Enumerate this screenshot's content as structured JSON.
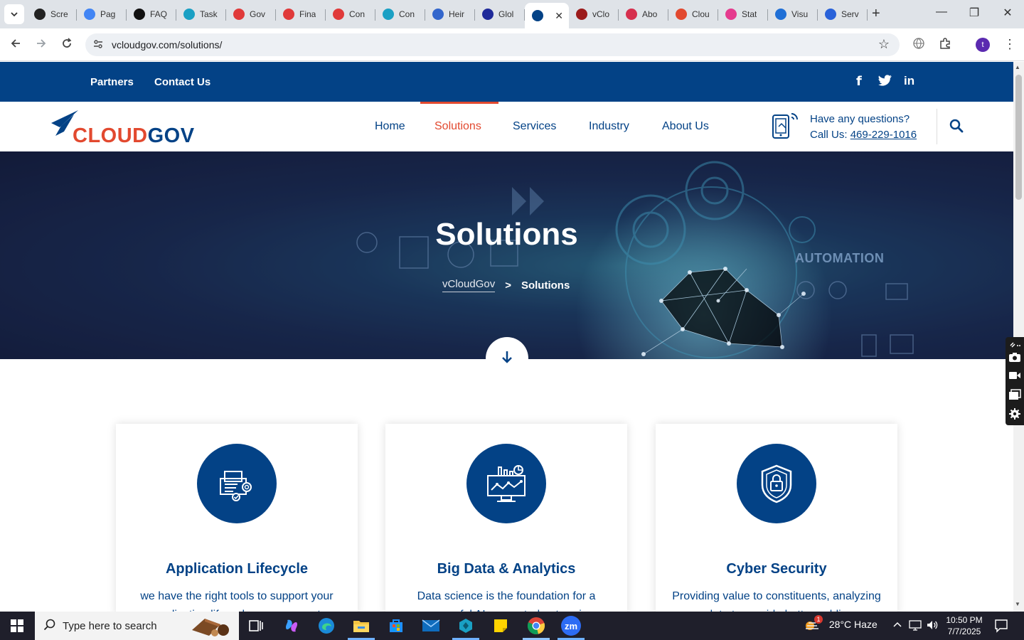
{
  "browser": {
    "tabs": [
      {
        "label": "Scre",
        "color": "#222222"
      },
      {
        "label": "Pag",
        "color": "#4285f4"
      },
      {
        "label": "FAQ",
        "color": "#111111"
      },
      {
        "label": "Task",
        "color": "#1aa0c4"
      },
      {
        "label": "Gov",
        "color": "#e03a3a"
      },
      {
        "label": "Fina",
        "color": "#e03a3a"
      },
      {
        "label": "Con",
        "color": "#e03a3a"
      },
      {
        "label": "Con",
        "color": "#1aa0c4"
      },
      {
        "label": "Heir",
        "color": "#3366cc"
      },
      {
        "label": "Glol",
        "color": "#1f2a9a"
      },
      {
        "label": "",
        "color": "#034286",
        "active": true
      },
      {
        "label": "vClo",
        "color": "#9c1b1b"
      },
      {
        "label": "Abo",
        "color": "#d6304e"
      },
      {
        "label": "Clou",
        "color": "#e2492f"
      },
      {
        "label": "Stat",
        "color": "#e53b8e"
      },
      {
        "label": "Visu",
        "color": "#1f6fd6"
      },
      {
        "label": "Serv",
        "color": "#2962d9"
      }
    ],
    "active_close": "✕",
    "new_tab": "+",
    "url": "vcloudgov.com/solutions/",
    "profile_initial": "t"
  },
  "site": {
    "topbar": {
      "partners": "Partners",
      "contact": "Contact Us",
      "facebook": "f",
      "linkedin": "in"
    },
    "logo": {
      "part1": "CLOUD",
      "part2": "GOV"
    },
    "menu": {
      "home": "Home",
      "solutions": "Solutions",
      "services": "Services",
      "industry": "Industry",
      "about": "About Us"
    },
    "contact": {
      "questions": "Have any questions?",
      "call_label": "Call Us: ",
      "phone": "469-229-1016"
    },
    "hero": {
      "title": "Solutions",
      "breadcrumb_home": "vCloudGov",
      "breadcrumb_sep": ">",
      "breadcrumb_current": "Solutions",
      "bg_text": "AUTOMATION"
    },
    "cards": [
      {
        "title": "Application Lifecycle",
        "desc": "we have the right tools to support your application lifecycle management"
      },
      {
        "title": "Big Data & Analytics",
        "desc": "Data science is the foundation for a successful AI-supported enterprise"
      },
      {
        "title": "Cyber Security",
        "desc": "Providing value to constituents, analyzing data to provide better public"
      }
    ]
  },
  "taskbar": {
    "search_placeholder": "Type here to search",
    "weather": "28°C  Haze",
    "weather_badge": "1",
    "time": "10:50 PM",
    "date": "7/7/2025",
    "zoom_label": "zm"
  },
  "colors": {
    "brand_blue": "#034286",
    "brand_orange": "#e2492f"
  }
}
